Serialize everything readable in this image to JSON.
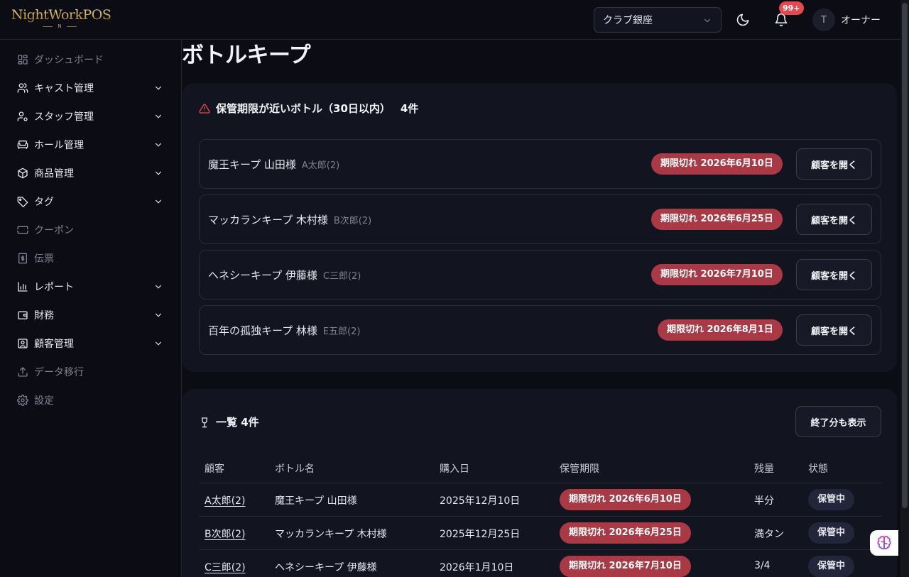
{
  "header": {
    "logo_text": "NightWorkPOS",
    "logo_mark": "N",
    "store": "クラブ銀座",
    "notification_badge": "99+",
    "avatar_initial": "T",
    "user_name": "オーナー"
  },
  "sidebar": {
    "items": [
      {
        "label": "ダッシュボード",
        "icon": "dashboard-icon",
        "muted": true,
        "chevron": false
      },
      {
        "label": "キャスト管理",
        "icon": "users-icon",
        "muted": false,
        "chevron": true
      },
      {
        "label": "スタッフ管理",
        "icon": "user-cog-icon",
        "muted": false,
        "chevron": true
      },
      {
        "label": "ホール管理",
        "icon": "sofa-icon",
        "muted": false,
        "chevron": true
      },
      {
        "label": "商品管理",
        "icon": "package-icon",
        "muted": false,
        "chevron": true
      },
      {
        "label": "タグ",
        "icon": "tag-icon",
        "muted": false,
        "chevron": true
      },
      {
        "label": "クーポン",
        "icon": "ticket-icon",
        "muted": true,
        "chevron": false
      },
      {
        "label": "伝票",
        "icon": "receipt-icon",
        "muted": true,
        "chevron": false
      },
      {
        "label": "レポート",
        "icon": "bar-chart-icon",
        "muted": false,
        "chevron": true
      },
      {
        "label": "財務",
        "icon": "wallet-icon",
        "muted": false,
        "chevron": true
      },
      {
        "label": "顧客管理",
        "icon": "contact-icon",
        "muted": false,
        "chevron": true
      },
      {
        "label": "データ移行",
        "icon": "upload-icon",
        "muted": true,
        "chevron": false
      },
      {
        "label": "設定",
        "icon": "gear-icon",
        "muted": true,
        "chevron": false
      }
    ]
  },
  "main": {
    "title": "ボトルキープ",
    "alert": {
      "title": "保管期限が近いボトル（30日以内）",
      "count": "4件",
      "open_label": "顧客を開く",
      "rows": [
        {
          "name": "魔王キープ 山田様",
          "customer": "A太郎(2)",
          "expiry": "期限切れ 2026年6月10日"
        },
        {
          "name": "マッカランキープ 木村様",
          "customer": "B次郎(2)",
          "expiry": "期限切れ 2026年6月25日"
        },
        {
          "name": "ヘネシーキープ 伊藤様",
          "customer": "C三郎(2)",
          "expiry": "期限切れ 2026年7月10日"
        },
        {
          "name": "百年の孤独キープ 林様",
          "customer": "E五郎(2)",
          "expiry": "期限切れ 2026年8月1日"
        }
      ]
    },
    "list": {
      "title": "一覧 4件",
      "show_ended_label": "終了分も表示",
      "columns": [
        "顧客",
        "ボトル名",
        "購入日",
        "保管期限",
        "残量",
        "状態"
      ],
      "rows": [
        {
          "customer": "A太郎(2)",
          "bottle": "魔王キープ 山田様",
          "purchased": "2025年12月10日",
          "expiry": "期限切れ 2026年6月10日",
          "remaining": "半分",
          "status": "保管中"
        },
        {
          "customer": "B次郎(2)",
          "bottle": "マッカランキープ 木村様",
          "purchased": "2025年12月25日",
          "expiry": "期限切れ 2026年6月25日",
          "remaining": "満タン",
          "status": "保管中"
        },
        {
          "customer": "C三郎(2)",
          "bottle": "ヘネシーキープ 伊藤様",
          "purchased": "2026年1月10日",
          "expiry": "期限切れ 2026年7月10日",
          "remaining": "3/4",
          "status": "保管中"
        }
      ]
    }
  },
  "colors": {
    "background": "#0b0c14",
    "card": "#121420",
    "danger_pill": "#a93945",
    "badge": "#e5484d",
    "logo_gold": "#c9a54f"
  }
}
